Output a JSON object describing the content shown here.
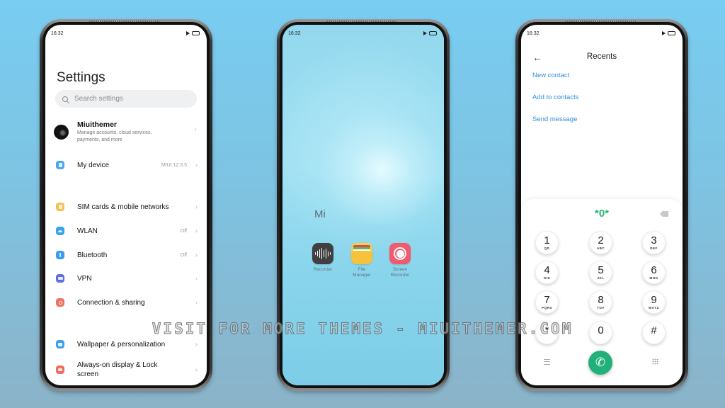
{
  "status_bar": {
    "time": "16:32"
  },
  "settings": {
    "title": "Settings",
    "search_placeholder": "Search settings",
    "account": {
      "name": "Miuithemer",
      "subtitle": "Manage accounts, cloud services, payments, and more"
    },
    "items": [
      {
        "label": "My device",
        "value": "MIUI 12.5.5",
        "icon": "device-icon",
        "color": "#4aa8ec"
      },
      {
        "label": "SIM cards & mobile networks",
        "value": "",
        "icon": "sim-icon",
        "color": "#f5c04e"
      },
      {
        "label": "WLAN",
        "value": "Off",
        "icon": "wifi-icon",
        "color": "#3aa3ee"
      },
      {
        "label": "Bluetooth",
        "value": "Off",
        "icon": "bluetooth-icon",
        "color": "#3a9cf0"
      },
      {
        "label": "VPN",
        "value": "",
        "icon": "vpn-icon",
        "color": "#5d6ee6"
      },
      {
        "label": "Connection & sharing",
        "value": "",
        "icon": "connection-sharing-icon",
        "color": "#ee7466"
      },
      {
        "label": "Wallpaper & personalization",
        "value": "",
        "icon": "wallpaper-icon",
        "color": "#3b9ff0"
      },
      {
        "label": "Always-on display & Lock screen",
        "value": "",
        "icon": "lock-icon",
        "color": "#ef6d62"
      }
    ]
  },
  "home": {
    "folder_title": "Mi",
    "apps": [
      {
        "label": "Recorder",
        "icon": "recorder-icon"
      },
      {
        "label": "File Manager",
        "icon": "file-manager-icon"
      },
      {
        "label": "Screen Recorder",
        "icon": "screen-recorder-icon"
      }
    ]
  },
  "dialer": {
    "title": "Recents",
    "links": [
      "New contact",
      "Add to contacts",
      "Send message"
    ],
    "display": "*0*",
    "keys": [
      {
        "num": "1",
        "letters": "QD"
      },
      {
        "num": "2",
        "letters": "ABC"
      },
      {
        "num": "3",
        "letters": "DEF"
      },
      {
        "num": "4",
        "letters": "GHI"
      },
      {
        "num": "5",
        "letters": "JKL"
      },
      {
        "num": "6",
        "letters": "MNO"
      },
      {
        "num": "7",
        "letters": "PQRS"
      },
      {
        "num": "8",
        "letters": "TUV"
      },
      {
        "num": "9",
        "letters": "WXYZ"
      },
      {
        "num": "*",
        "letters": ""
      },
      {
        "num": "0",
        "letters": ""
      },
      {
        "num": "#",
        "letters": ""
      }
    ],
    "accent_color": "#22b07a"
  },
  "watermark": "VISIT FOR MORE THEMES - MIUITHEMER.COM"
}
